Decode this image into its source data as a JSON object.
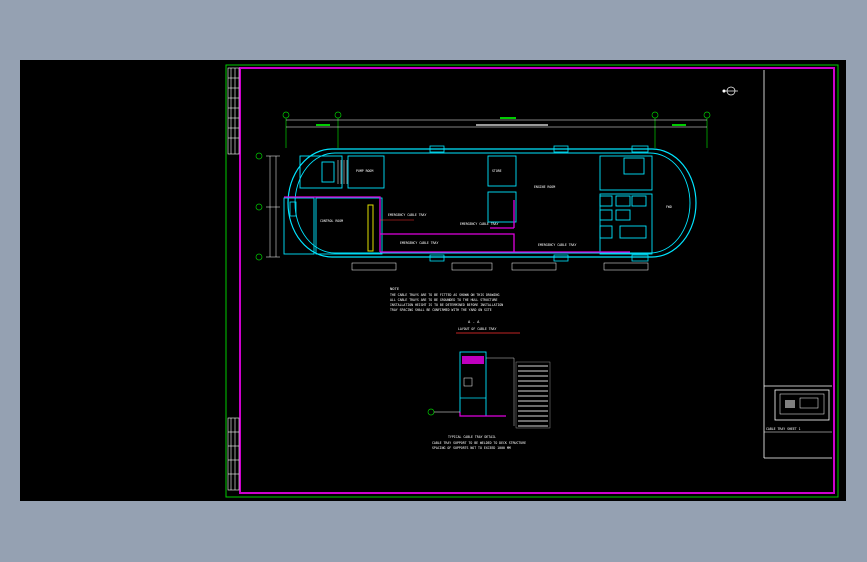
{
  "window": {
    "title": ""
  },
  "colors": {
    "background": "#95a1b2",
    "viewport": "#000000",
    "frame": "#00cc00",
    "border": "#cc00cc",
    "wall": "#00e5ff",
    "white": "#ffffff",
    "red": "#ff3030",
    "yellow": "#e0e000"
  },
  "drawing": {
    "labels": {
      "spaces": [
        "PUMP ROOM",
        "ENGINE ROOM",
        "CONTROL ROOM",
        "EMERGENCY CABLE TRAY",
        "EMERGENCY CABLE TRAY",
        "EMERGENCY CABLE TRAY",
        "EMERGENCY CABLE TRAY",
        "STORE",
        "FWD"
      ],
      "note_title": "NOTE",
      "note_lines": [
        "THE CABLE TRAYS ARE TO BE FITTED AS SHOWN ON THIS DRAWING",
        "ALL CABLE TRAYS ARE TO BE GROUNDED TO THE HULL STRUCTURE",
        "INSTALLATION HEIGHT IS TO BE DETERMINED BEFORE INSTALLATION",
        "TRAY SPACING SHALL BE CONFIRMED WITH THE YARD ON SITE"
      ],
      "section_mark": "A - A",
      "section_title": "LAYOUT OF CABLE TRAY",
      "detail_title": "TYPICAL CABLE TRAY DETAIL",
      "detail_notes": [
        "CABLE TRAY SUPPORT TO BE WELDED TO DECK STRUCTURE",
        "SPACING OF SUPPORTS NOT TO EXCEED 1000 MM"
      ],
      "titleblock_caption": "CABLE TRAY   SHEET 1"
    }
  }
}
